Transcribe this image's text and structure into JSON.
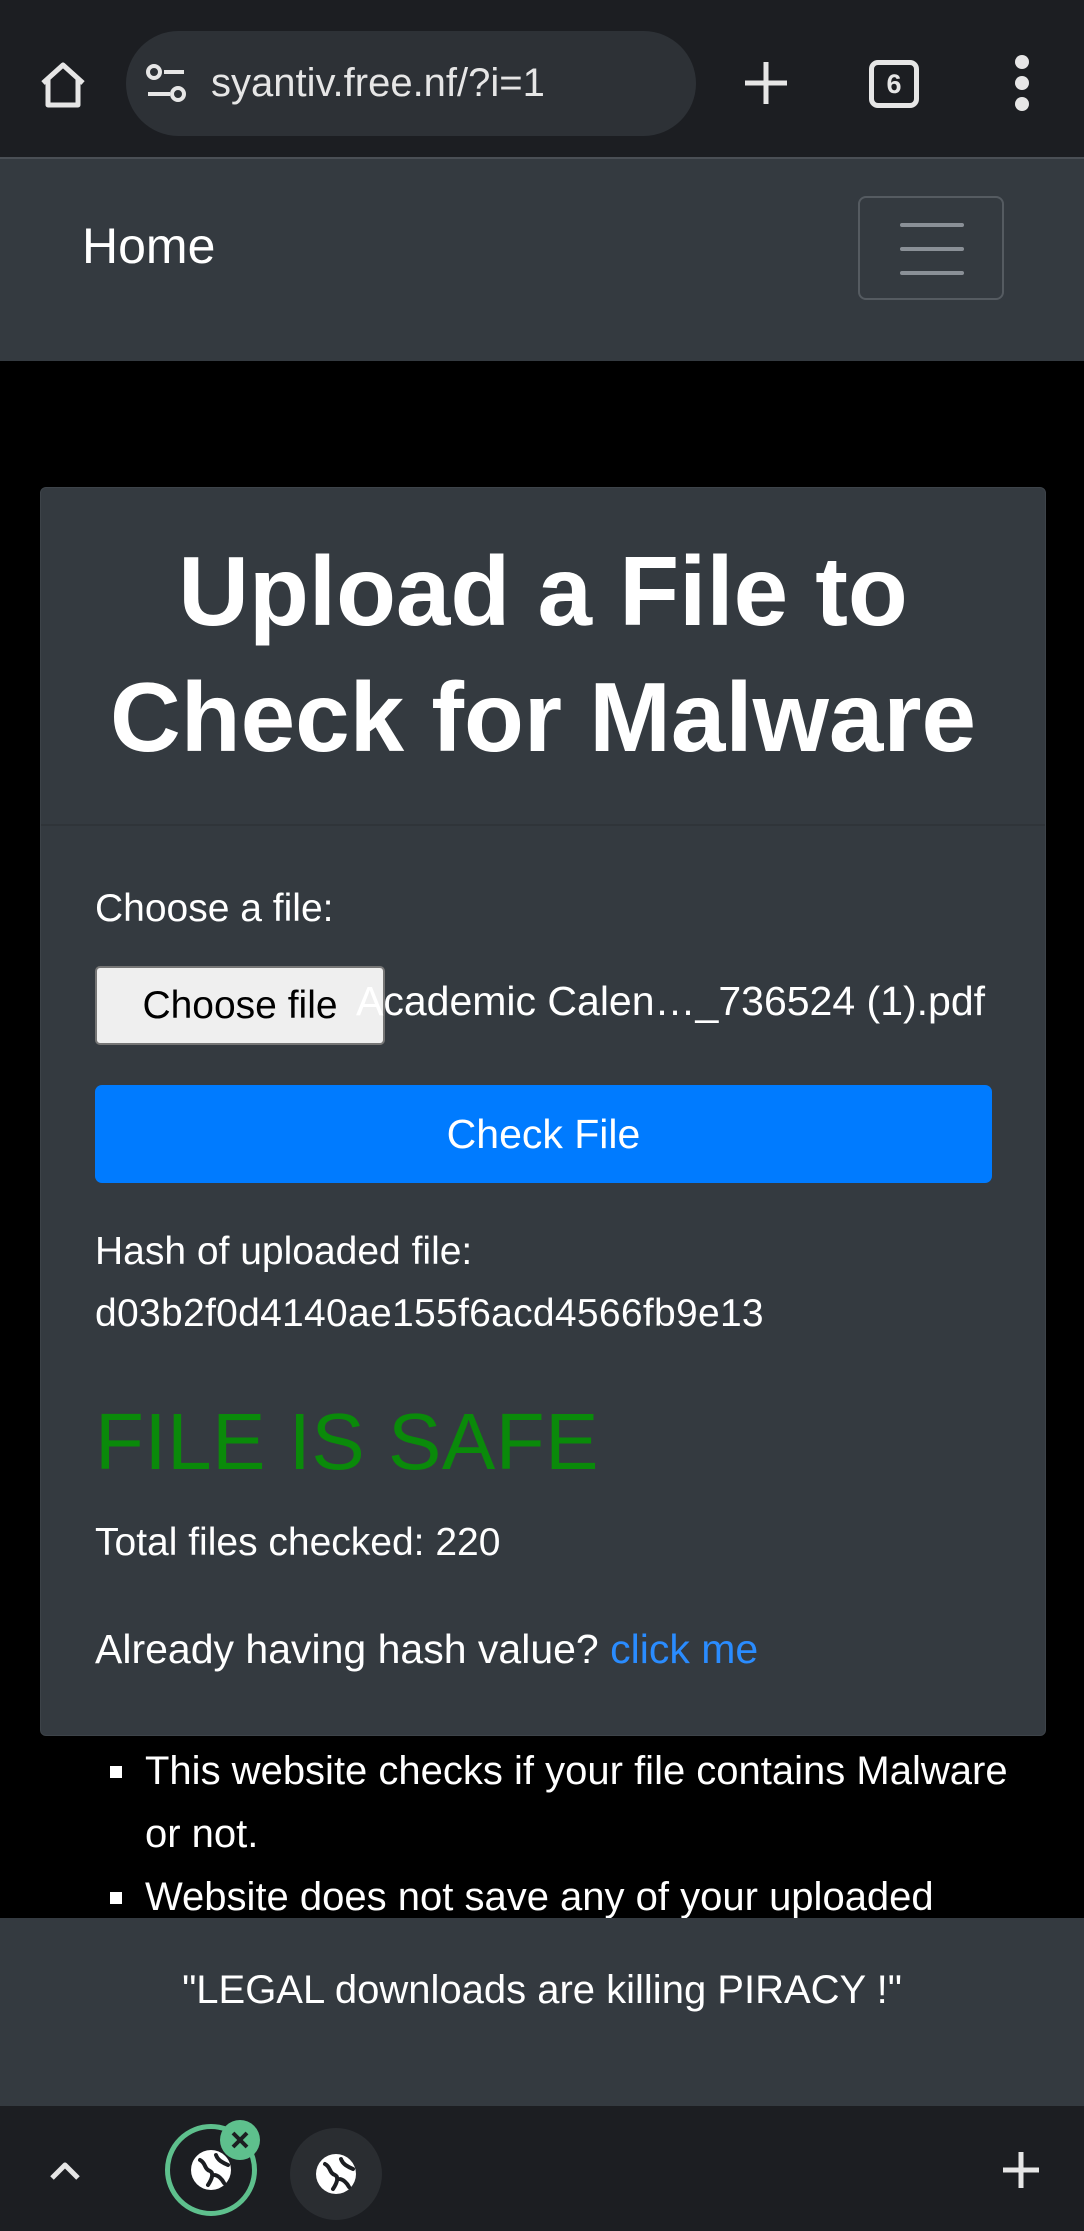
{
  "browser": {
    "url": "syantiv.free.nf/?i=1",
    "tab_count": "6"
  },
  "navbar": {
    "brand": "Home"
  },
  "card": {
    "title_line1": "Upload a File to",
    "title_line2": "Check for Malware",
    "choose_label": "Choose a file:",
    "choose_button": "Choose file",
    "file_name": "Academic Calen…_736524 (1).pdf",
    "check_button": "Check File",
    "hash_label": "Hash of uploaded file:",
    "hash_value": "d03b2f0d4140ae155f6acd4566fb9e13",
    "result": "FILE IS SAFE",
    "total_checked": "Total files checked: 220",
    "already_text": "Already having hash value?",
    "click_link": "click me"
  },
  "info": {
    "items": [
      "This website checks if your file contains Malware or not.",
      "Website does not save any of your uploaded"
    ]
  },
  "footer": {
    "quote": "\"LEGAL downloads are killing PIRACY !\""
  },
  "colors": {
    "primary_button": "#007bff",
    "safe_green": "#0a8a0a",
    "link_blue": "#2a8cff",
    "panel_bg": "#343a40",
    "active_tab_ring": "#5ec08d"
  }
}
